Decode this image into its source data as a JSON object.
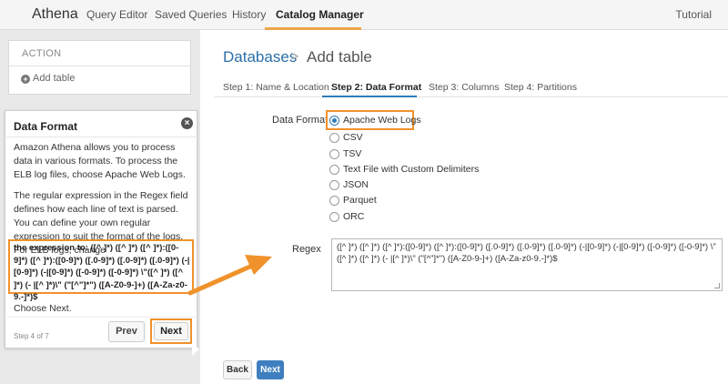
{
  "nav": {
    "brand": "Athena",
    "items": [
      "Query Editor",
      "Saved Queries",
      "History",
      "Catalog Manager"
    ],
    "tutorial": "Tutorial"
  },
  "sidebar": {
    "action_header": "ACTION",
    "add_table": "Add table"
  },
  "tooltip": {
    "title": "Data Format",
    "para1": "Amazon Athena allows you to process data in various formats. To process the ELB log files, choose Apache Web Logs.",
    "para2": "The regular expression in the Regex field defines how each line of text is parsed. You can define your own regular expression to suit the format of the logs. For ELB logs, change",
    "regex_text": "the expression to: ([^ ]*) ([^ ]*) ([^ ]*):([0-9]*) ([^ ]*):([0-9]*) ([.0-9]*) ([.0-9]*) ([.0-9]*) (-|[0-9]*) (-|[0-9]*) ([-0-9]*) ([-0-9]*) \\\"([^ ]*) ([^ ]*) (- |[^ ]*)\\\" (\"[^\"]*\") ([A-Z0-9-]+) ([A-Za-z0-9.-]*)$",
    "choose_next": "Choose Next.",
    "prev_label": "Prev",
    "next_label": "Next",
    "step_of": "Step 4 of 7"
  },
  "breadcrumb": {
    "parent": "Databases",
    "current": "Add table"
  },
  "steps": [
    "Step 1: Name & Location",
    "Step 2: Data Format",
    "Step 3: Columns",
    "Step 4: Partitions"
  ],
  "form": {
    "data_format_label": "Data Format",
    "formats": [
      "Apache Web Logs",
      "CSV",
      "TSV",
      "Text File with Custom Delimiters",
      "JSON",
      "Parquet",
      "ORC"
    ],
    "selected_format": "Apache Web Logs",
    "regex_label": "Regex",
    "regex_value": "([^ ]*) ([^ ]*) ([^ ]*):([0-9]*) ([^ ]*):([0-9]*) ([.0-9]*) ([.0-9]*) ([.0-9]*) (-|[0-9]*) (-|[0-9]*) ([-0-9]*) ([-0-9]*) \\\"([^ ]*) ([^ ]*) (- |[^ ]*)\\\" (\"[^\"]*\") ([A-Z0-9-]+) ([A-Za-z0-9.-]*)$",
    "back_label": "Back",
    "next_label": "Next"
  },
  "colors": {
    "accent_orange": "#f0922b",
    "link_blue": "#2b6fa8",
    "primary_button": "#3f7fbf"
  }
}
